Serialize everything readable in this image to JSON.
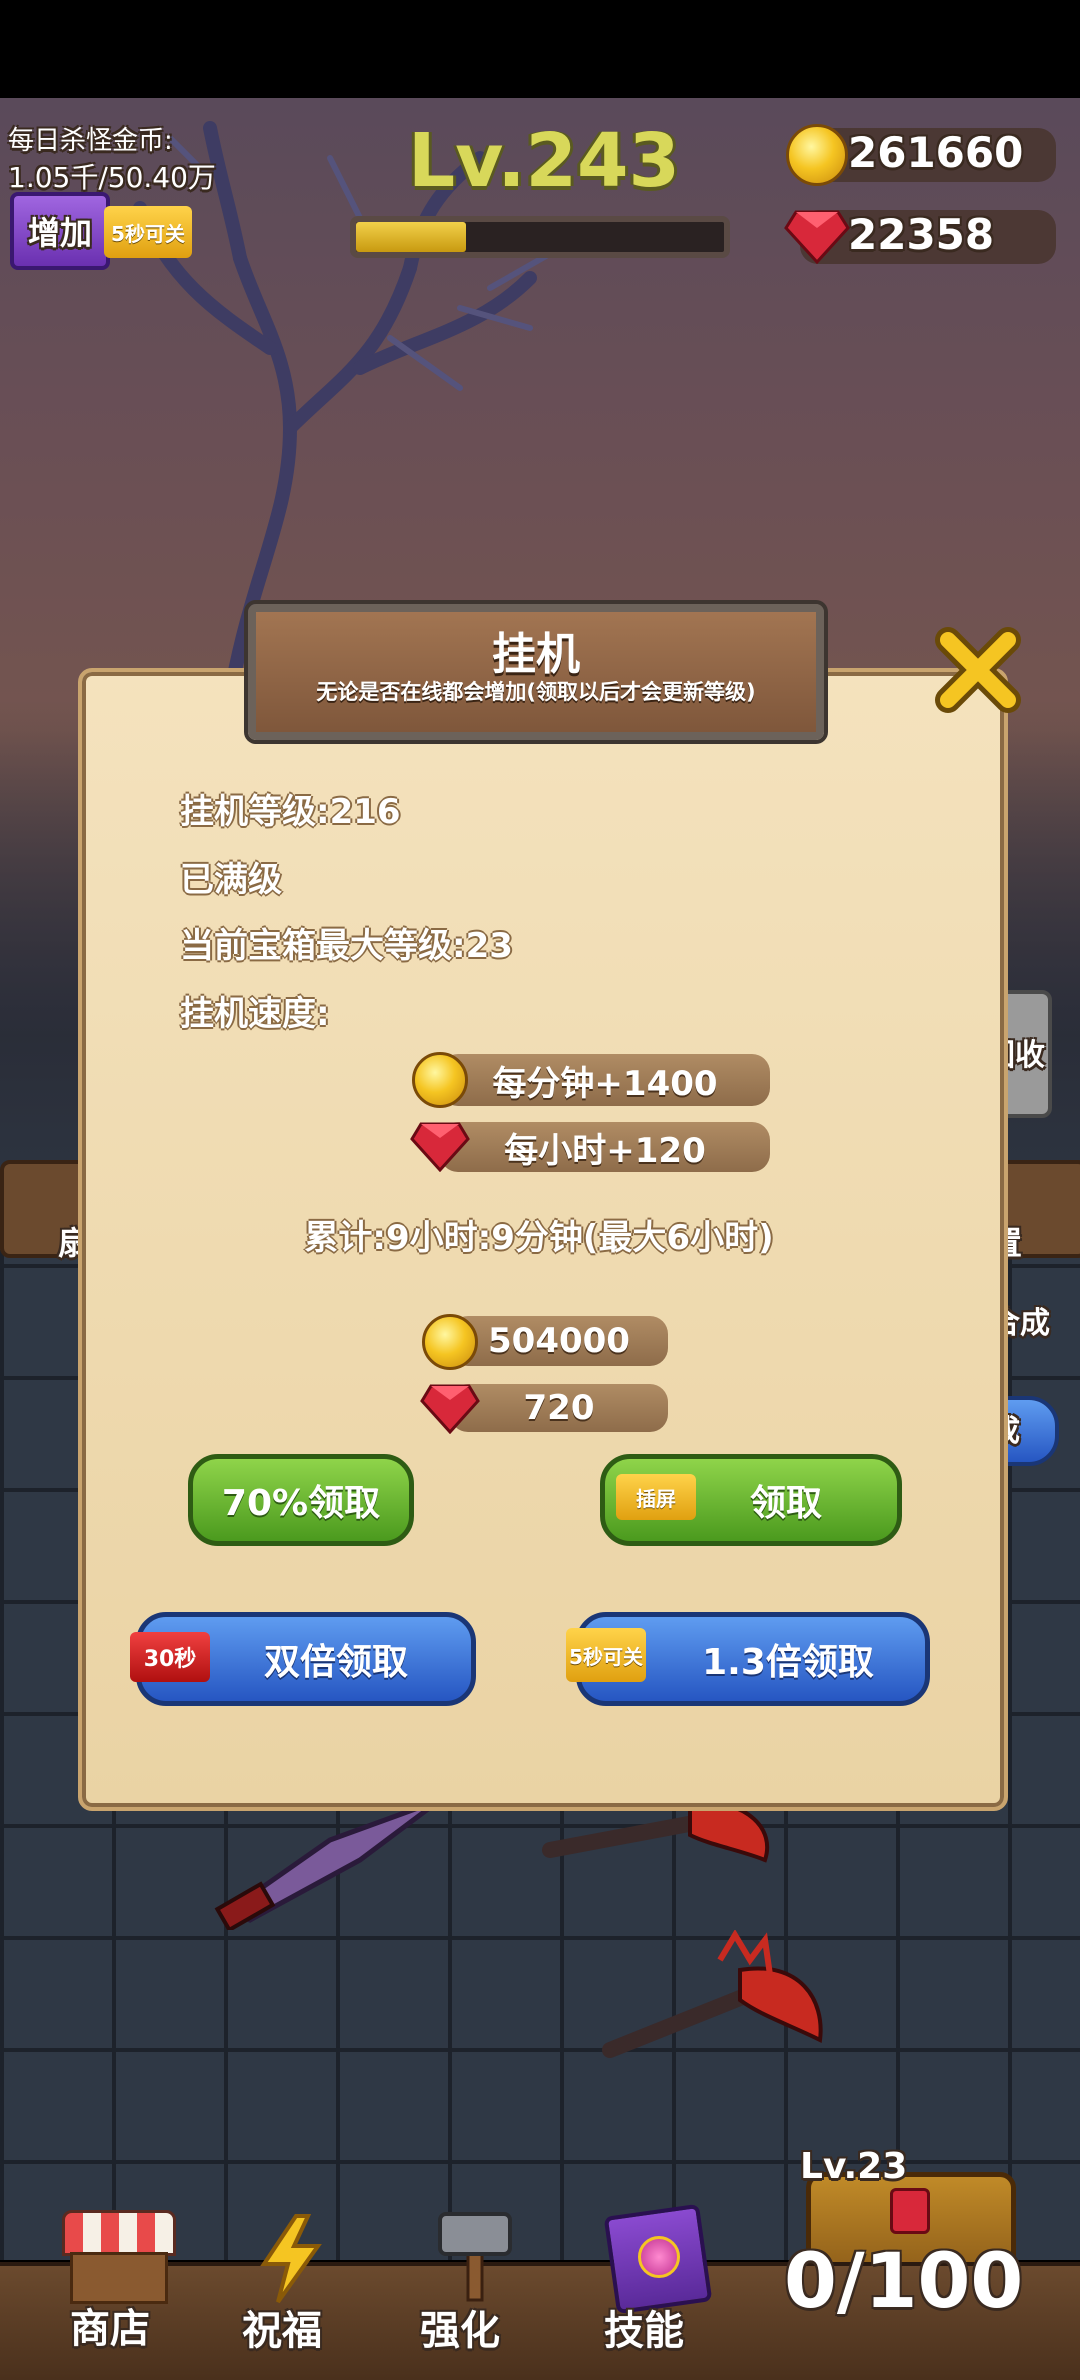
{
  "hud": {
    "daily_kill_label": "每日杀怪金币:",
    "daily_kill_value": "1.05千/50.40万",
    "add_button": "增加",
    "video_badge_small": "5秒可关",
    "level": "Lv.243",
    "level_progress": 0.3,
    "gold": "261660",
    "gems": "22358"
  },
  "dialog": {
    "title": "挂机",
    "subtitle": "无论是否在线都会增加(领取以后才会更新等级)",
    "idle_level": "挂机等级:216",
    "max_level_note": "已满级",
    "chest_max_level": "当前宝箱最大等级:23",
    "speed_label": "挂机速度:",
    "gold_rate": "每分钟+1400",
    "gem_rate": "每小时+120",
    "accumulated": "累计:9小时:9分钟(最大6小时)",
    "reward_gold": "504000",
    "reward_gems": "720",
    "claim_70": "70%领取",
    "claim_ad_badge": "插屏",
    "claim": "领取",
    "double_badge": "30秒",
    "double_claim": "双倍领取",
    "x13_badge": "5秒可关",
    "x13_claim": "1.3倍领取"
  },
  "side_labels": {
    "left_partial": "扇",
    "right_recycle": "回收",
    "right_set": "置",
    "right_merge": "合成",
    "right_blue": "成"
  },
  "chest": {
    "level": "Lv.23",
    "count": "0/100"
  },
  "nav": {
    "shop": "商店",
    "bless": "祝福",
    "enhance": "强化",
    "skills": "技能"
  },
  "colors": {
    "level_text": "#d8d85a",
    "accent_green": "#4b9a1e",
    "accent_blue": "#2656c2",
    "gold": "#f5c522",
    "gem": "#d8283a"
  }
}
